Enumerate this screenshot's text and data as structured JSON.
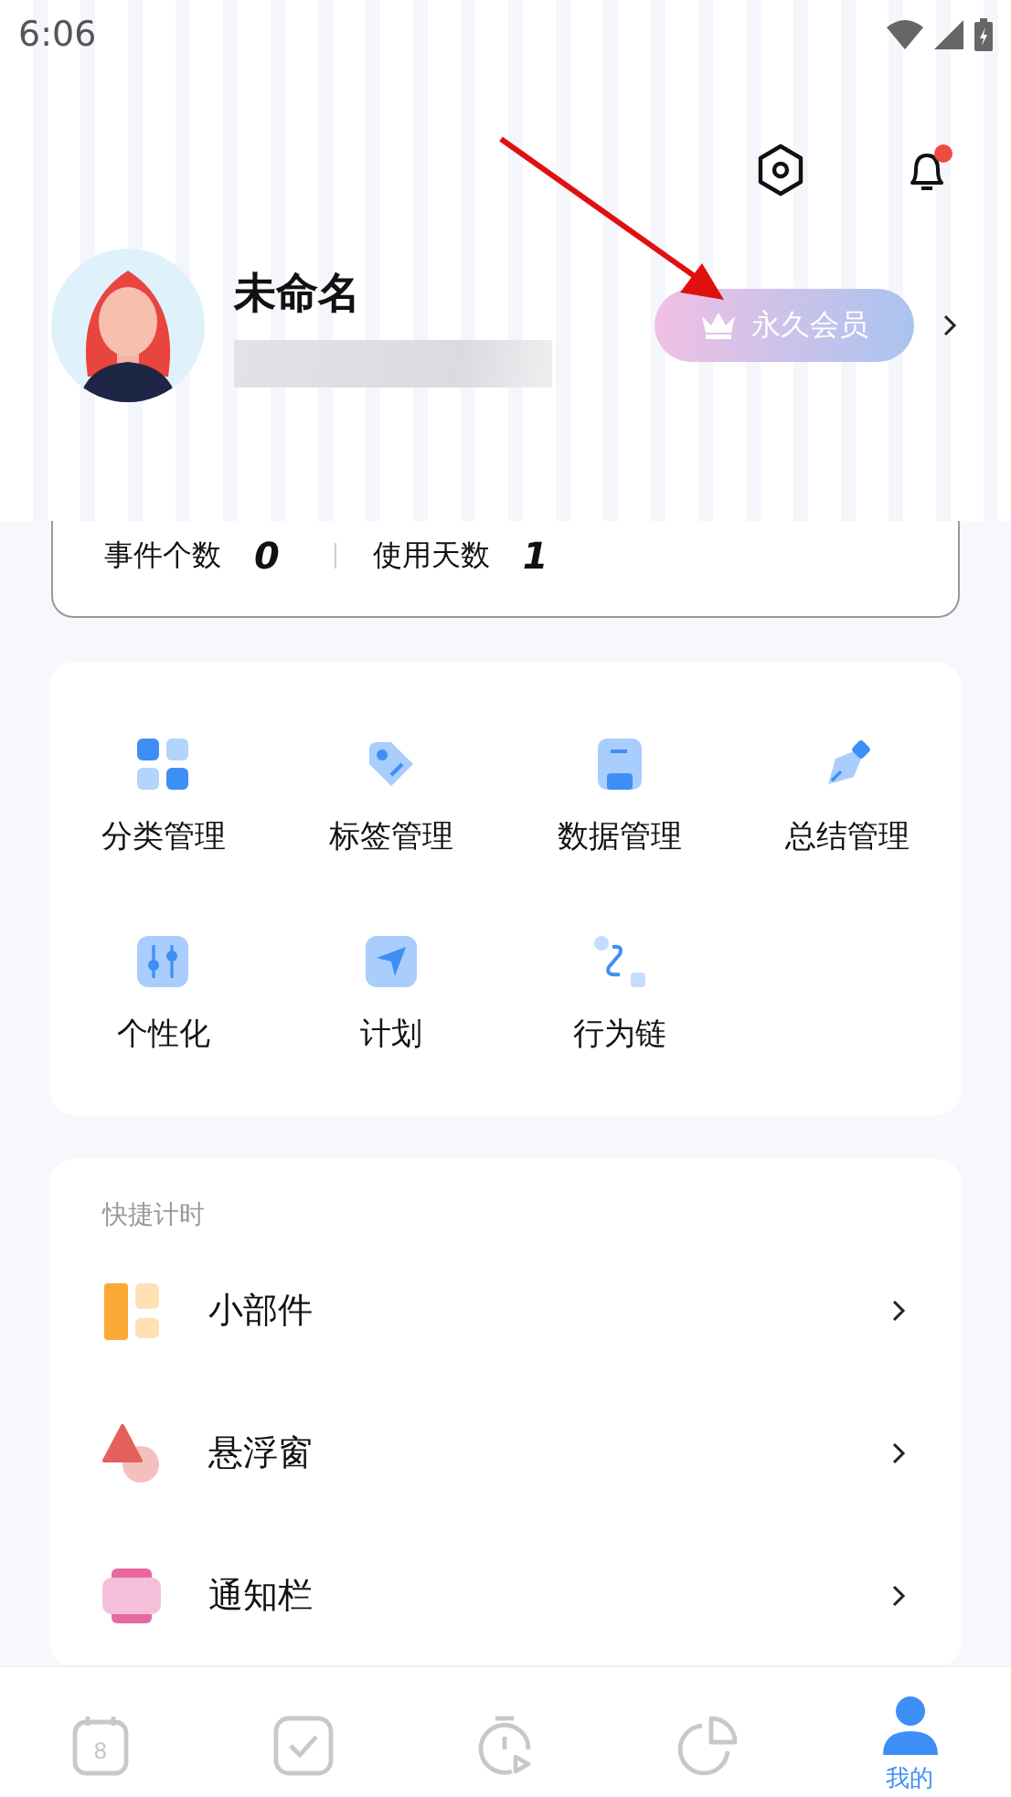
{
  "status_bar": {
    "time": "6:06"
  },
  "header": {
    "notification_badge": true
  },
  "profile": {
    "name": "未命名",
    "membership": "永久会员"
  },
  "stats": [
    {
      "label": "事件个数",
      "value": "0"
    },
    {
      "label": "使用天数",
      "value": "1"
    }
  ],
  "tools": [
    {
      "kind": "category",
      "label": "分类管理"
    },
    {
      "kind": "tag",
      "label": "标签管理"
    },
    {
      "kind": "data",
      "label": "数据管理"
    },
    {
      "kind": "summary",
      "label": "总结管理"
    },
    {
      "kind": "personalize",
      "label": "个性化"
    },
    {
      "kind": "plan",
      "label": "计划"
    },
    {
      "kind": "chain",
      "label": "行为链"
    }
  ],
  "quick_timer": {
    "title": "快捷计时",
    "items": [
      {
        "kind": "widget",
        "label": "小部件"
      },
      {
        "kind": "floating",
        "label": "悬浮窗"
      },
      {
        "kind": "notification",
        "label": "通知栏"
      }
    ]
  },
  "tab_bar": [
    {
      "kind": "calendar",
      "number": "8",
      "selected": false
    },
    {
      "kind": "todo",
      "selected": false
    },
    {
      "kind": "timer",
      "selected": false
    },
    {
      "kind": "stats",
      "selected": false
    },
    {
      "kind": "me",
      "label": "我的",
      "selected": true
    }
  ]
}
